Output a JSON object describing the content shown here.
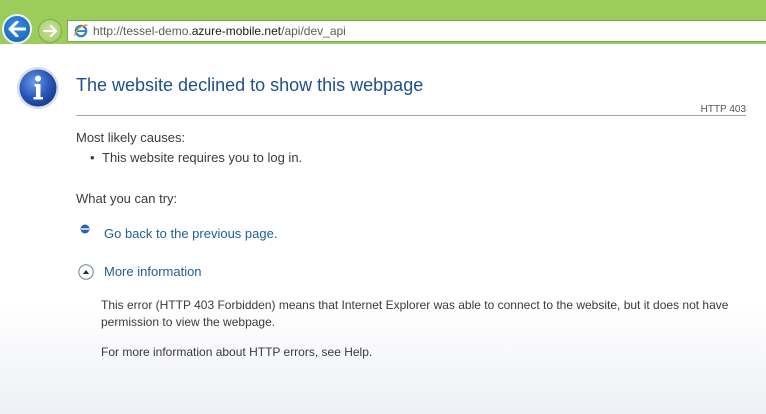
{
  "browser": {
    "address_bar": {
      "url_prefix": "http://tessel-demo.",
      "url_host": "azure-mobile.net",
      "url_path": "/api/dev_api"
    },
    "colors": {
      "toolbar": "#9ccc5a",
      "back_button": "#1c6fbf"
    }
  },
  "error_page": {
    "title": "The website declined to show this webpage",
    "status_code": "HTTP 403",
    "causes_heading": "Most likely causes:",
    "causes": [
      "This website requires you to log in."
    ],
    "try_heading": "What you can try:",
    "go_back_label": "Go back to the previous page.",
    "more_info_label": "More information",
    "more_info_text_1": "This error (HTTP 403 Forbidden) means that Internet Explorer was able to connect to the website, but it does not have permission to view the webpage.",
    "more_info_text_2": "For more information about HTTP errors, see Help.",
    "colors": {
      "title": "#1f4f8f",
      "link": "#1f5f94"
    }
  }
}
